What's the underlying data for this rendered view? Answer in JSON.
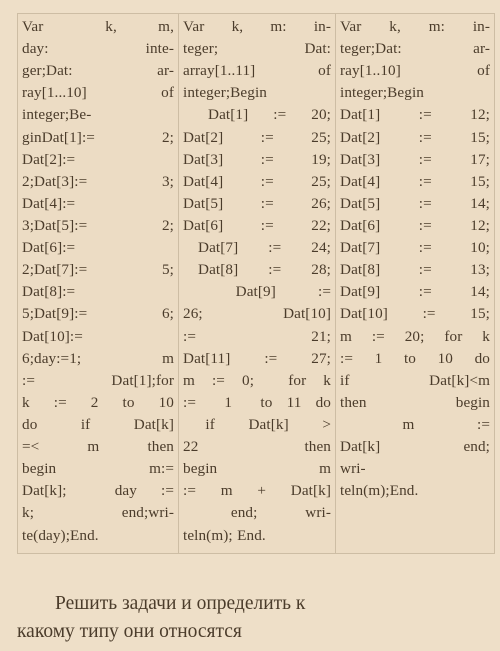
{
  "document": {
    "background_color": "#eedfc8",
    "cell_background_color": "#ecdcc4",
    "text_color": "#4b3c2b",
    "border_color": "#cdbda4"
  },
  "table": {
    "columns": [
      {
        "name": "task-1",
        "lines": [
          "Var      k,    m,",
          "day:        inte-",
          "ger;Dat:      ar-",
          "ray[1...10]    of",
          "integer;Be-",
          "ginDat[1]:=   2;",
          "Dat[2]:=",
          "2;Dat[3]:=     3;",
          "Dat[4]:=",
          "3;Dat[5]:=     2;",
          "Dat[6]:=",
          "2;Dat[7]:=     5;",
          "Dat[8]:=",
          "5;Dat[9]:=     6;",
          "Dat[10]:=",
          "6;day:=1;     m",
          ":=   Dat[1];for",
          "k  :=  2  to  10",
          "do   if   Dat[k]",
          "=<    m    then",
          "begin      m:=",
          "Dat[k];  day :=",
          "k;     end;wri-",
          "te(day);End."
        ],
        "plain_text": "Var k, m, day: integer;Dat: array[1...10] of integer;Begin Dat[1]:= 2; Dat[2]:= 2;Dat[3]:= 3; Dat[4]:= 3;Dat[5]:= 2; Dat[6]:= 2;Dat[7]:= 5; Dat[8]:= 5;Dat[9]:= 6; Dat[10]:= 6;day:=1; m := Dat[1];for k := 2 to 10 do if Dat[k] =< m then begin m:= Dat[k]; day := k; end;write(day);End."
      },
      {
        "name": "task-2",
        "lines": [
          "Var  k,  m:  in-",
          "teger;       Dat:",
          "array[1..11]  of",
          "integer;Begin",
          "  Dat[1]  :=  20;",
          "Dat[2]   :=   25;",
          "Dat[3]   :=   19;",
          "Dat[4]   :=   25;",
          "Dat[5]   :=   26;",
          "Dat[6]  :=  22;",
          " Dat[7]  :=  24;",
          " Dat[8]  :=  28;",
          "     Dat[9]    :=",
          "26;     Dat[10]",
          ":=        21;",
          "Dat[11]  :=  27;",
          "m := 0;  for k",
          ":=  1  to 11 do",
          "  if   Dat[k]   >",
          "22         then",
          "begin         m",
          ":= m + Dat[k]",
          "   end;   wri-",
          "teln(m); End."
        ],
        "plain_text": "Var k, m: integer; Dat: array[1..11] of integer;Begin Dat[1] := 20; Dat[2] := 25; Dat[3] := 19; Dat[4] := 25; Dat[5] := 26; Dat[6] := 22; Dat[7] := 24; Dat[8] := 28; Dat[9] := 26; Dat[10] := 21; Dat[11] := 27; m := 0; for k := 1 to 11 do if Dat[k] > 22 then begin m := m + Dat[k] end; writeln(m); End."
      },
      {
        "name": "task-3",
        "lines": [
          "Var  k,  m:  in-",
          "teger;Dat:   ar-",
          "ray[1..10]     of",
          "integer;Begin",
          "Dat[1]   :=   12;",
          "Dat[2]   :=   15;",
          "Dat[3]   :=   17;",
          "Dat[4]   :=   15;",
          "Dat[5]   :=   14;",
          "Dat[6]   :=   12;",
          "Dat[7]   :=   10;",
          "Dat[8]   :=   13;",
          "Dat[9]   :=   14;",
          "Dat[10]  :=  15;",
          "m := 20; for k",
          ":=  1  to  10  do",
          "if   Dat[k]<m",
          "then      begin",
          "      m      :=",
          "Dat[k]     end;",
          "wri-",
          "teln(m);End."
        ],
        "plain_text": "Var k, m: integer;Dat: array[1..10] of integer;Begin Dat[1] := 12; Dat[2] := 15; Dat[3] := 17; Dat[4] := 15; Dat[5] := 14; Dat[6] := 12; Dat[7] := 10; Dat[8] := 13; Dat[9] := 14; Dat[10] := 15; m := 20; for k := 1 to 10 do if Dat[k]<m then begin m := Dat[k] end; writeln(m);End."
      }
    ]
  },
  "caption": {
    "line1": "Решить задачи и определить к",
    "line2": "какому типу они относятся",
    "full_text": "Решить задачи и определить к какому типу они относятся"
  }
}
